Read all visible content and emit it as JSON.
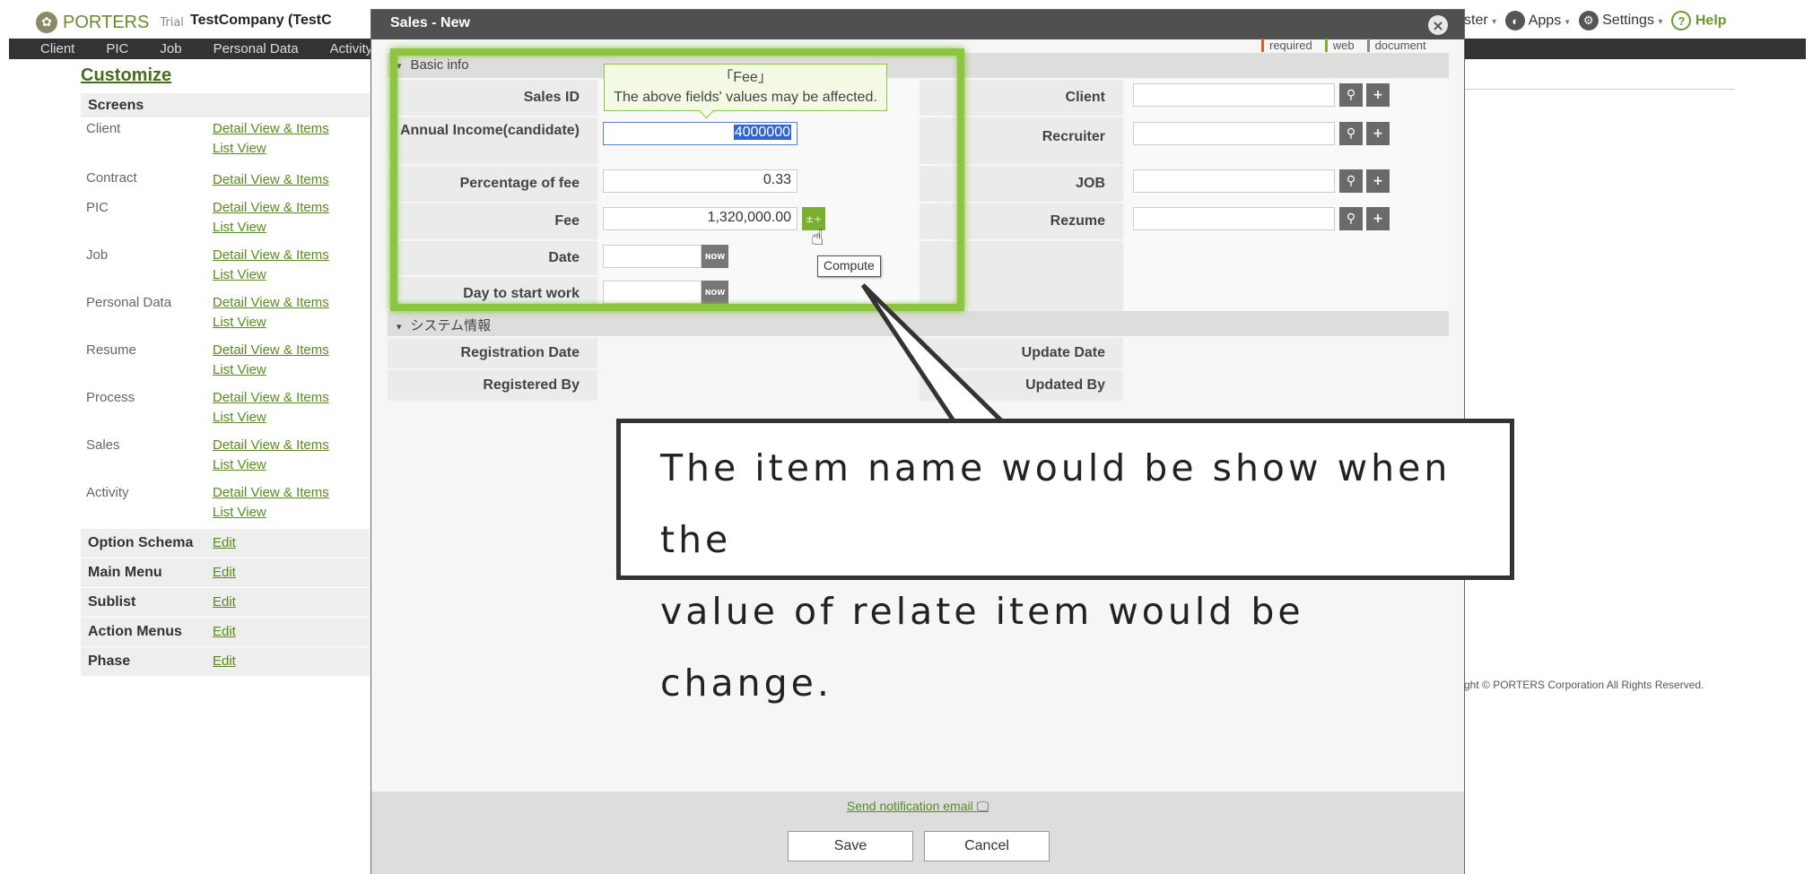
{
  "header": {
    "logo_text": "PORTERS",
    "trial": "Trial",
    "company": "TestCompany (TestC",
    "topright": {
      "master": "ster",
      "apps": "Apps",
      "settings": "Settings",
      "help": "Help"
    }
  },
  "nav": {
    "items": [
      "Client",
      "PIC",
      "Job",
      "Personal Data",
      "Activity"
    ]
  },
  "sidebar": {
    "title": "Customize",
    "screens_header": "Screens",
    "detail": "Detail View & Items",
    "list": "List View",
    "rows": [
      {
        "name": "Client",
        "list": true
      },
      {
        "name": "Contract",
        "list": false
      },
      {
        "name": "PIC",
        "list": true
      },
      {
        "name": "Job",
        "list": true
      },
      {
        "name": "Personal Data",
        "list": true
      },
      {
        "name": "Resume",
        "list": true
      },
      {
        "name": "Process",
        "list": true
      },
      {
        "name": "Sales",
        "list": true
      },
      {
        "name": "Activity",
        "list": true
      }
    ],
    "options": [
      "Option Schema",
      "Main Menu",
      "Sublist",
      "Action Menus",
      "Phase"
    ],
    "edit": "Edit"
  },
  "copyright": "ght © PORTERS Corporation All Rights Reserved.",
  "modal": {
    "title": "Sales - New",
    "close": "×",
    "legend": {
      "required": "required",
      "web": "web",
      "document": "document"
    },
    "section1": "Basic info",
    "section2": "システム情報",
    "fields": {
      "sales_id": "Sales ID",
      "annual_income": "Annual Income(candidate)",
      "annual_income_value": "4000000",
      "percentage": "Percentage of fee",
      "percentage_value": "0.33",
      "fee": "Fee",
      "fee_value": "1,320,000.00",
      "date": "Date",
      "day_start": "Day to start work",
      "client": "Client",
      "recruiter": "Recruiter",
      "job": "JOB",
      "rezume": "Rezume",
      "reg_date": "Registration Date",
      "reg_by": "Registered By",
      "upd_date": "Update Date",
      "upd_by": "Updated By"
    },
    "now": "NOW",
    "tooltip": {
      "title": "「Fee」",
      "text": "The above fields' values may be affected."
    },
    "compute": "Compute",
    "notify": "Send notification email",
    "save": "Save",
    "cancel": "Cancel"
  },
  "callout": {
    "line1": "The item name would be show when the",
    "line2": "value of relate item would be change."
  },
  "icons": {
    "search": "search-icon",
    "plus": "plus-icon",
    "calculator": "calculator-icon",
    "close": "close-icon",
    "monitor": "monitor-icon"
  }
}
